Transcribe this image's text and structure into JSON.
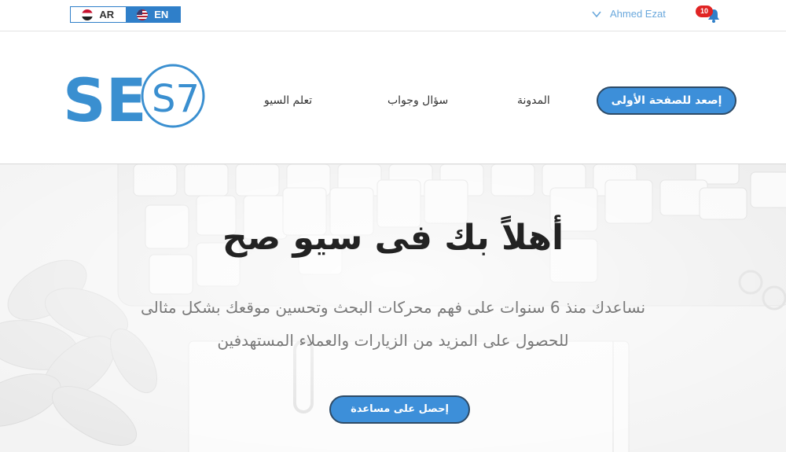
{
  "topbar": {
    "lang_ar": "AR",
    "lang_en": "EN",
    "user_name": "Ahmed Ezat",
    "notification_count": "10"
  },
  "logo": {
    "se": "SE",
    "s7": "S7"
  },
  "nav": {
    "cta": "إصعد للصفحة الأولى",
    "blog": "المدونة",
    "qa": "سؤال وجواب",
    "learn": "تعلم السيو"
  },
  "hero": {
    "title": "أهلاً بك فى سيو صح",
    "line1": "نساعدك منذ 6 سنوات على فهم محركات البحث وتحسين موقعك بشكل مثالى",
    "line2": "للحصول على المزيد من الزيارات والعملاء المستهدفين",
    "cta": "إحصل على مساعدة"
  },
  "colors": {
    "brand_blue": "#3d8fd9",
    "logo_blue": "#3a8fd0",
    "badge_red": "#e02424"
  },
  "icons": [
    "egypt-flag-icon",
    "us-flag-icon",
    "chevron-down-icon",
    "bell-icon"
  ]
}
